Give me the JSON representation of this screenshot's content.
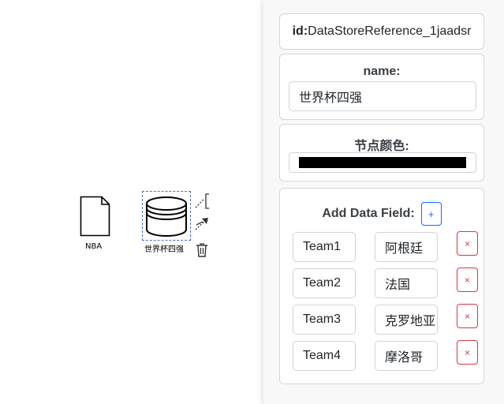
{
  "canvas": {
    "nodes": [
      {
        "type": "data-object-icon",
        "label": "NBA"
      },
      {
        "type": "data-store-icon",
        "label": "世界杯四强",
        "selected": true
      }
    ],
    "context_pad": [
      "text-annotation-icon",
      "connect-arrow-icon",
      "trash-icon"
    ]
  },
  "panel": {
    "id_label": "id:",
    "id_value": "DataStoreReference_1jaadsr",
    "name_label": "name:",
    "name_value": "世界杯四强",
    "color_label": "节点颜色:",
    "color_value": "#000000",
    "add_field_label": "Add Data Field:",
    "add_button": "+",
    "delete_button": "×",
    "fields": [
      {
        "key": "Team1",
        "value": "阿根廷"
      },
      {
        "key": "Team2",
        "value": "法国"
      },
      {
        "key": "Team3",
        "value": "克罗地亚"
      },
      {
        "key": "Team4",
        "value": "摩洛哥"
      }
    ]
  }
}
